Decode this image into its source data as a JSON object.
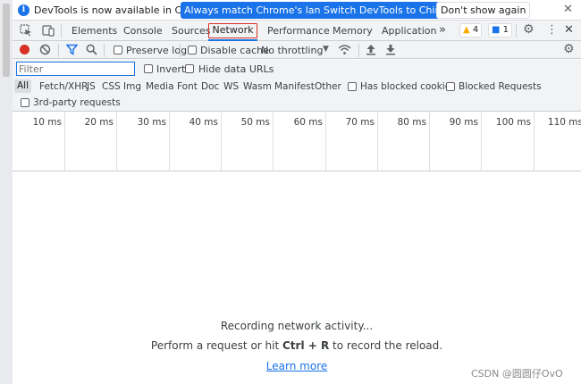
{
  "infobar": {
    "message": "DevTools is now available in Chinese!",
    "btn_match": "Always match Chrome's language",
    "btn_switch": "Switch DevTools to Chinese",
    "btn_dismiss": "Don't show again",
    "close_icon": "close-icon"
  },
  "tabs": {
    "elements": "Elements",
    "console": "Console",
    "sources": "Sources",
    "network": "Network",
    "performance": "Performance",
    "memory": "Memory",
    "application": "Application",
    "more": "»",
    "warnings_count": "4",
    "messages_count": "1"
  },
  "network_toolbar": {
    "preserve_log": "Preserve log",
    "disable_cache": "Disable cache",
    "throttling": "No throttling"
  },
  "filter": {
    "placeholder": "Filter",
    "invert": "Invert",
    "hide_data_urls": "Hide data URLs"
  },
  "types": {
    "all": "All",
    "fetch_xhr": "Fetch/XHR",
    "js": "JS",
    "css": "CSS",
    "img": "Img",
    "media": "Media",
    "font": "Font",
    "doc": "Doc",
    "ws": "WS",
    "wasm": "Wasm",
    "manifest": "Manifest",
    "other": "Other",
    "blocked_cookies": "Has blocked cookies",
    "blocked_requests": "Blocked Requests",
    "third_party": "3rd-party requests"
  },
  "timeline": {
    "ticks": [
      "10 ms",
      "20 ms",
      "30 ms",
      "40 ms",
      "50 ms",
      "60 ms",
      "70 ms",
      "80 ms",
      "90 ms",
      "100 ms",
      "110 ms"
    ]
  },
  "empty_state": {
    "recording": "Recording network activity...",
    "perform_prefix": "Perform a request or hit ",
    "shortcut": "Ctrl + R",
    "perform_suffix": " to record the reload.",
    "learn_more": "Learn more"
  },
  "watermark": "CSDN @圆圆仔OvO",
  "colors": {
    "accent": "#1a73e8",
    "record": "#d93025",
    "toolbar_bg": "#f1f3f4",
    "warning": "#f9ab00"
  }
}
